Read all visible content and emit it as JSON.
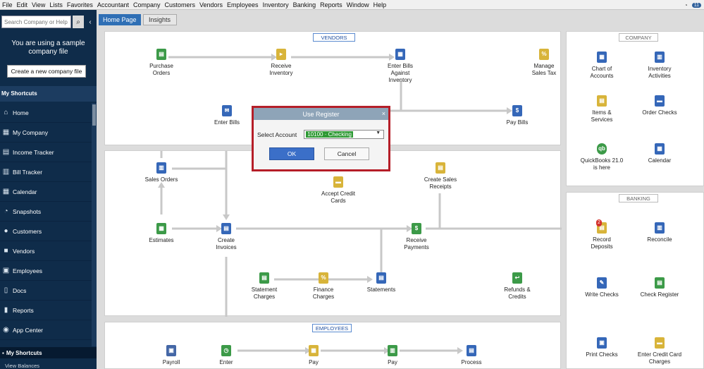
{
  "menu": [
    "File",
    "Edit",
    "View",
    "Lists",
    "Favorites",
    "Accountant",
    "Company",
    "Customers",
    "Vendors",
    "Employees",
    "Inventory",
    "Banking",
    "Reports",
    "Window",
    "Help"
  ],
  "menu_right": {
    "clock": "◔",
    "notifications": "11"
  },
  "sidebar": {
    "search_placeholder": "Search Company or Help",
    "search_icon": "search-icon",
    "sample_text": "You are using a sample company file",
    "create_button": "Create a new company file",
    "section_title": "My Shortcuts",
    "items": [
      {
        "label": "Home",
        "icon": "home-icon"
      },
      {
        "label": "My Company",
        "icon": "company-icon"
      },
      {
        "label": "Income Tracker",
        "icon": "income-tracker-icon"
      },
      {
        "label": "Bill Tracker",
        "icon": "bill-tracker-icon"
      },
      {
        "label": "Calendar",
        "icon": "calendar-icon"
      },
      {
        "label": "Snapshots",
        "icon": "snapshots-icon"
      },
      {
        "label": "Customers",
        "icon": "customers-icon"
      },
      {
        "label": "Vendors",
        "icon": "vendors-icon"
      },
      {
        "label": "Employees",
        "icon": "employees-icon"
      },
      {
        "label": "Docs",
        "icon": "docs-icon"
      },
      {
        "label": "Reports",
        "icon": "reports-icon"
      },
      {
        "label": "App Center",
        "icon": "app-center-icon"
      }
    ],
    "bottom_tab": "My Shortcuts",
    "bottom_tab2": "View Balances"
  },
  "tabs": {
    "home": "Home Page",
    "insights": "Insights"
  },
  "sections": {
    "vendors": "VENDORS",
    "employees": "EMPLOYEES",
    "company": "COMPANY",
    "banking": "BANKING"
  },
  "vendors_nodes": {
    "purchase_orders": "Purchase Orders",
    "receive_inventory": "Receive Inventory",
    "enter_bills_against_inventory": "Enter Bills Against Inventory",
    "manage_sales_tax": "Manage Sales Tax",
    "enter_bills": "Enter Bills",
    "pay_bills": "Pay Bills"
  },
  "customers_nodes": {
    "sales_orders": "Sales Orders",
    "accept_credit_cards": "Accept Credit Cards",
    "create_sales_receipts": "Create Sales Receipts",
    "estimates": "Estimates",
    "create_invoices": "Create Invoices",
    "receive_payments": "Receive Payments",
    "statement_charges": "Statement Charges",
    "finance_charges": "Finance Charges",
    "statements": "Statements",
    "refunds_credits": "Refunds & Credits"
  },
  "employees_nodes": {
    "payroll": "Payroll",
    "enter": "Enter",
    "pay1": "Pay",
    "pay2": "Pay",
    "process": "Process"
  },
  "company_nodes": {
    "chart_of_accounts": "Chart of Accounts",
    "inventory_activities": "Inventory Activities",
    "items_services": "Items & Services",
    "order_checks": "Order Checks",
    "quickbooks": "QuickBooks 21.0 is here",
    "calendar": "Calendar"
  },
  "banking_nodes": {
    "record_deposits": "Record Deposits",
    "deposits_badge": "2",
    "reconcile": "Reconcile",
    "write_checks": "Write Checks",
    "check_register": "Check Register",
    "print_checks": "Print Checks",
    "enter_credit_card_charges": "Enter Credit Card Charges"
  },
  "dialog": {
    "title": "Use Register",
    "close": "×",
    "select_label": "Select Account",
    "selected_value": "10100 · Checking",
    "ok": "OK",
    "cancel": "Cancel"
  }
}
